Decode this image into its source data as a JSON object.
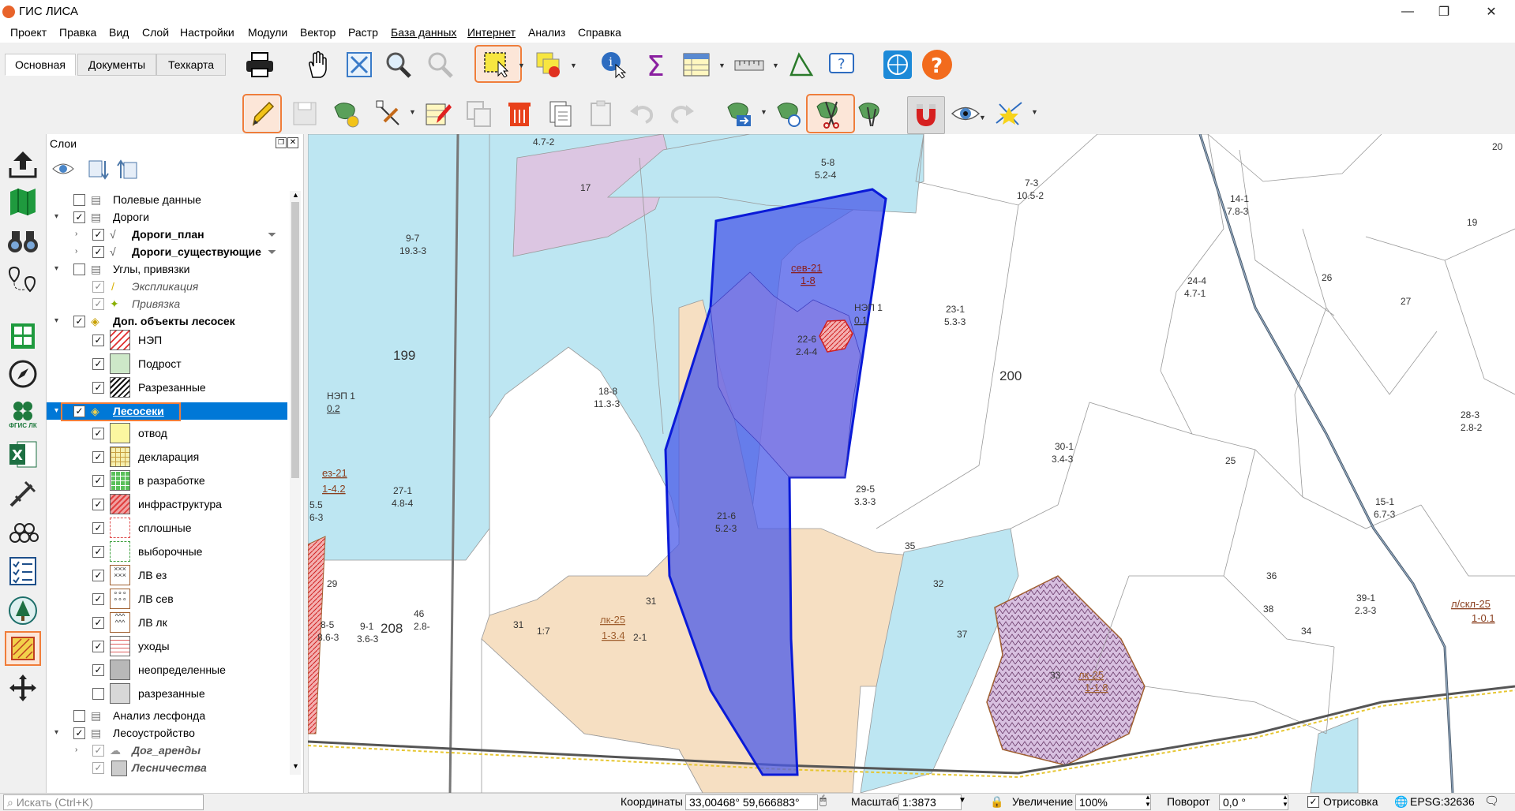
{
  "window": {
    "title": "ГИС ЛИСА",
    "minimize": "—",
    "maximize": "❐",
    "close": "✕"
  },
  "menu": [
    "Проект",
    "Правка",
    "Вид",
    "Слой",
    "Настройки",
    "Модули",
    "Вектор",
    "Растр",
    "База данных",
    "Интернет",
    "Анализ",
    "Справка"
  ],
  "tabs": [
    "Основная",
    "Документы",
    "Техкарта"
  ],
  "layers_panel": {
    "title": "Слои",
    "items": [
      {
        "label": "Полевые данные",
        "checked": false
      },
      {
        "label": "Дороги",
        "checked": true
      },
      {
        "label": "Дороги_план",
        "checked": true
      },
      {
        "label": "Дороги_существующие",
        "checked": true
      },
      {
        "label": "Углы, привязки",
        "checked": false
      },
      {
        "label": "Экспликация",
        "checked": true
      },
      {
        "label": "Привязка",
        "checked": true
      },
      {
        "label": "Доп. объекты лесосек",
        "checked": true
      },
      {
        "label": "НЭП",
        "checked": true
      },
      {
        "label": "Подрост",
        "checked": true
      },
      {
        "label": "Разрезанные",
        "checked": true
      },
      {
        "label": "Лесосеки",
        "checked": true
      },
      {
        "label": "отвод",
        "checked": true
      },
      {
        "label": "декларация",
        "checked": true
      },
      {
        "label": "в разработке",
        "checked": true
      },
      {
        "label": "инфраструктура",
        "checked": true
      },
      {
        "label": "сплошные",
        "checked": true
      },
      {
        "label": "выборочные",
        "checked": true
      },
      {
        "label": "ЛВ ез",
        "checked": true
      },
      {
        "label": "ЛВ сев",
        "checked": true
      },
      {
        "label": "ЛВ лк",
        "checked": true
      },
      {
        "label": "уходы",
        "checked": true
      },
      {
        "label": "неопределенные",
        "checked": true
      },
      {
        "label": "разрезанные",
        "checked": false
      },
      {
        "label": "Анализ лесфонда",
        "checked": false
      },
      {
        "label": "Лесоустройство",
        "checked": true
      },
      {
        "label": "Дог_аренды",
        "checked": true
      },
      {
        "label": "Лесничества",
        "checked": true
      }
    ]
  },
  "sidebar_icon_labels": {
    "fgis": "ФГИС ЛК"
  },
  "map": {
    "labels": {
      "l472": "4.7-2",
      "l17": "17",
      "l58a": "5-8",
      "l58b": "5.2-4",
      "l73a": "7-3",
      "l73b": "10.5-2",
      "l141a": "14-1",
      "l141b": "7.8-3",
      "l20": "20",
      "l19": "19",
      "l26": "26",
      "l97a": "9-7",
      "l97b": "19.3-3",
      "lsev": "сев-21",
      "lsev2": "1-8",
      "lnep": "НЭП 1",
      "lnep2": "0.1",
      "l244a": "24-4",
      "l244b": "4.7-1",
      "l27": "27",
      "l226a": "22-6",
      "l226b": "2.4-4",
      "l231a": "23-1",
      "l231b": "5.3-3",
      "l199": "199",
      "l200": "200",
      "l188a": "18-8",
      "l188b": "11.3-3",
      "lnep1": "НЭП 1",
      "lnep1b": "0.2",
      "l283a": "28-3",
      "l283b": "2.8-2",
      "l301a": "30-1",
      "l301b": "3.4-3",
      "l25": "25",
      "lez": "ез-21",
      "lez2": "1-4.2",
      "l271a": "27-1",
      "l271b": "4.8-4",
      "l295a": "29-5",
      "l295b": "3.3-3",
      "l151a": "15-1",
      "l151b": "6.7-3",
      "l216a": "21-6",
      "l216b": "5.2-3",
      "l55": "5.5",
      "l63": "6-3",
      "l35": "35",
      "llk": "лк-25",
      "llk2": "1-1.8",
      "l33": "33",
      "l29": "29",
      "l32": "32",
      "l36": "36",
      "l31": "31",
      "l38": "38",
      "l391a": "39-1",
      "l391b": "2.3-3",
      "llsk": "л/скл-25",
      "llsk2": "1-0.1",
      "l85a": "8-5",
      "l85b": "8.6-3",
      "l91a": "9-1",
      "l91b": "3.6-3",
      "l208": "208",
      "l46": "46",
      "l28": "2.8-",
      "l31b": "31",
      "llk3": "лк-25",
      "llk4": "1-3.4",
      "l21": "2-1",
      "l37": "37",
      "l34": "34",
      "l17b": "1:7"
    }
  },
  "status": {
    "search_placeholder": "Искать (Ctrl+K)",
    "coords_label": "Координаты",
    "coords_value": "33,00468°  59,666883°",
    "scale_label": "Масштаб",
    "scale_value": "1:3873",
    "zoom_label": "Увеличение",
    "zoom_value": "100%",
    "rotation_label": "Поворот",
    "rotation_value": "0,0 °",
    "render_label": "Отрисовка",
    "crs": "EPSG:32636"
  }
}
